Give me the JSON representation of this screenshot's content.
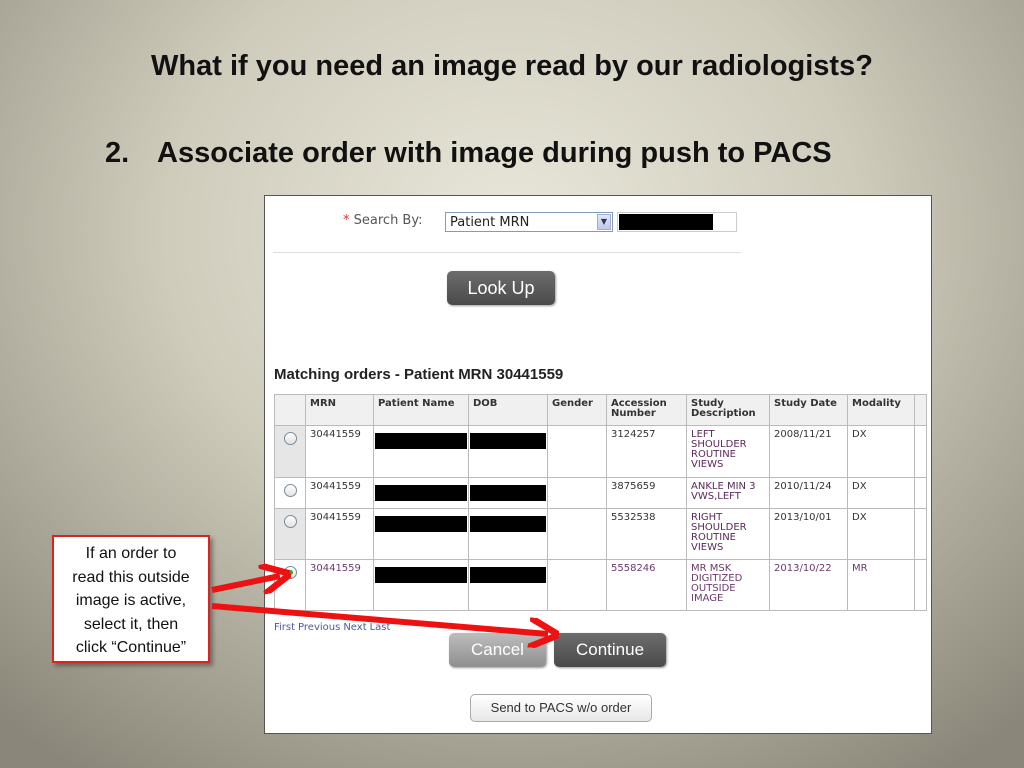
{
  "slide": {
    "title": "What if you need an image read by our radiologists?",
    "step_number": "2.",
    "step_text": "Associate order with image during push to PACS"
  },
  "form": {
    "required_marker": "*",
    "search_by_label": "Search By:",
    "search_by_value": "Patient MRN",
    "lookup_label": "Look Up"
  },
  "results": {
    "heading": "Matching orders - Patient MRN 30441559",
    "columns": [
      "MRN",
      "Patient Name",
      "DOB",
      "Gender",
      "Accession Number",
      "Study Description",
      "Study Date",
      "Modality"
    ],
    "rows": [
      {
        "mrn": "30441559",
        "gender": "",
        "accession": "3124257",
        "description": "LEFT SHOULDER ROUTINE VIEWS",
        "date": "2008/11/21",
        "modality": "DX",
        "selected": false
      },
      {
        "mrn": "30441559",
        "gender": "",
        "accession": "3875659",
        "description": "ANKLE MIN 3 VWS,LEFT",
        "date": "2010/11/24",
        "modality": "DX",
        "selected": false
      },
      {
        "mrn": "30441559",
        "gender": "",
        "accession": "5532538",
        "description": "RIGHT SHOULDER ROUTINE VIEWS",
        "date": "2013/10/01",
        "modality": "DX",
        "selected": false
      },
      {
        "mrn": "30441559",
        "gender": "",
        "accession": "5558246",
        "description": "MR MSK DIGITIZED OUTSIDE IMAGE",
        "date": "2013/10/22",
        "modality": "MR",
        "selected": true
      }
    ],
    "pager": [
      "First",
      "Previous",
      "Next",
      "Last"
    ]
  },
  "actions": {
    "cancel_label": "Cancel",
    "continue_label": "Continue",
    "send_label": "Send to PACS w/o order"
  },
  "callout": {
    "lines": [
      "If an order to",
      "read this outside",
      "image is active,",
      "select it, then",
      "click “Continue”"
    ]
  },
  "colors": {
    "arrow": "#ee1111",
    "callout_border": "#dd2222"
  }
}
